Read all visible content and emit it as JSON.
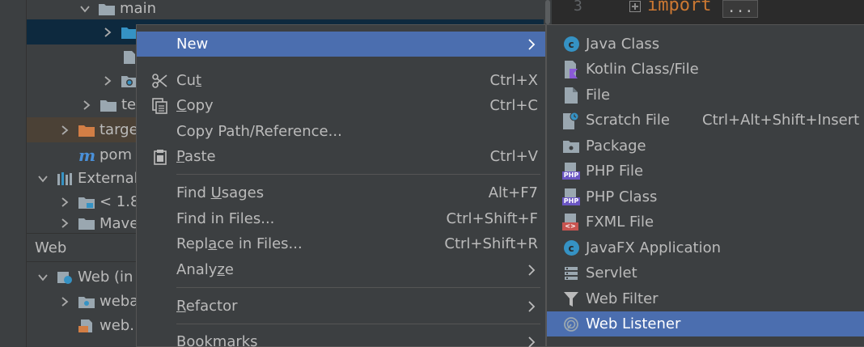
{
  "tree": {
    "rows": [
      {
        "label": "main"
      },
      {
        "label": ""
      },
      {
        "label": ""
      },
      {
        "label": ""
      },
      {
        "label": "te"
      },
      {
        "label": "targe"
      },
      {
        "label": "pom"
      },
      {
        "label": "External"
      },
      {
        "label": "< 1.8"
      },
      {
        "label": "Mave"
      }
    ],
    "web_panel_title": "Web",
    "web_rows": [
      {
        "label": "Web (in"
      },
      {
        "label": "weba"
      },
      {
        "label": "web."
      }
    ]
  },
  "editor": {
    "line_number": "3",
    "keyword": "import",
    "fold_placeholder": "..."
  },
  "context_menu": {
    "items": [
      {
        "label": "New",
        "shortcut": "",
        "has_submenu": true,
        "active": true
      },
      {
        "label_pre": "Cu",
        "label_u": "t",
        "label_post": "",
        "shortcut": "Ctrl+X",
        "icon": "scissors-icon"
      },
      {
        "label_pre": "",
        "label_u": "C",
        "label_post": "opy",
        "shortcut": "Ctrl+C",
        "icon": "copy-icon"
      },
      {
        "label": "Copy Path/Reference...",
        "shortcut": ""
      },
      {
        "label_pre": "",
        "label_u": "P",
        "label_post": "aste",
        "shortcut": "Ctrl+V",
        "icon": "clipboard-icon"
      },
      {
        "label_pre": "Find ",
        "label_u": "U",
        "label_post": "sages",
        "shortcut": "Alt+F7"
      },
      {
        "label": "Find in Files...",
        "shortcut": "Ctrl+Shift+F"
      },
      {
        "label_pre": "Repl",
        "label_u": "a",
        "label_post": "ce in Files...",
        "shortcut": "Ctrl+Shift+R"
      },
      {
        "label_pre": "Analy",
        "label_u": "z",
        "label_post": "e",
        "shortcut": "",
        "has_submenu": true
      },
      {
        "label_pre": "",
        "label_u": "R",
        "label_post": "efactor",
        "shortcut": "",
        "has_submenu": true
      },
      {
        "label": "Bookmarks",
        "shortcut": "",
        "has_submenu": true
      }
    ]
  },
  "submenu": {
    "items": [
      {
        "label": "Java Class",
        "icon": "java-class-icon"
      },
      {
        "label": "Kotlin Class/File",
        "icon": "kotlin-file-icon"
      },
      {
        "label": "File",
        "icon": "file-icon"
      },
      {
        "label": "Scratch File",
        "shortcut": "Ctrl+Alt+Shift+Insert",
        "icon": "scratch-file-icon"
      },
      {
        "label": "Package",
        "icon": "package-icon"
      },
      {
        "label": "PHP File",
        "icon": "php-file-icon"
      },
      {
        "label": "PHP Class",
        "icon": "php-class-icon"
      },
      {
        "label": "FXML File",
        "icon": "fxml-file-icon"
      },
      {
        "label": "JavaFX Application",
        "icon": "javafx-class-icon"
      },
      {
        "label": "Servlet",
        "icon": "servlet-icon"
      },
      {
        "label": "Web Filter",
        "icon": "filter-icon"
      },
      {
        "label": "Web Listener",
        "icon": "listener-icon",
        "active": true
      }
    ],
    "php_badge": "PHP",
    "fxml_badge": "<>",
    "class_badge": "c"
  },
  "colors": {
    "highlight": "#4b6eaf",
    "menu_bg": "#3c3f41",
    "editor_bg": "#2b2b2b",
    "keyword": "#cc7832",
    "folder": "#9aa7b0",
    "excluded_folder": "#d27e45"
  }
}
